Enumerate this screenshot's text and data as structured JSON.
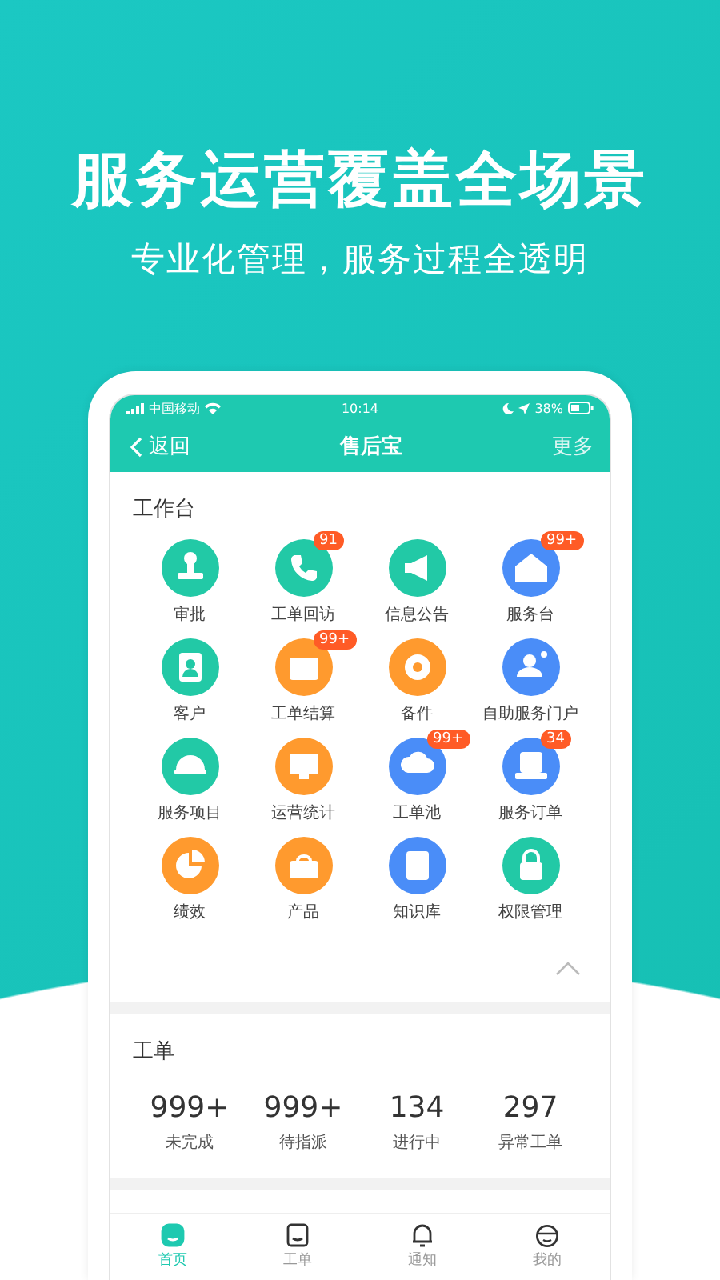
{
  "headline": "服务运营覆盖全场景",
  "subtitle": "专业化管理，服务过程全透明",
  "status_bar": {
    "carrier": "中国移动",
    "time": "10:14",
    "battery": "38%"
  },
  "nav": {
    "back": "返回",
    "title": "售后宝",
    "more": "更多"
  },
  "workbench": {
    "title": "工作台",
    "items": [
      {
        "label": "审批",
        "color": "#22c9a6"
      },
      {
        "label": "工单回访",
        "color": "#22c9a6",
        "badge": "91"
      },
      {
        "label": "信息公告",
        "color": "#22c9a6"
      },
      {
        "label": "服务台",
        "color": "#4a8df8",
        "badge": "99+"
      },
      {
        "label": "客户",
        "color": "#22c9a6"
      },
      {
        "label": "工单结算",
        "color": "#ff9a2e",
        "badge": "99+"
      },
      {
        "label": "备件",
        "color": "#ff9a2e"
      },
      {
        "label": "自助服务门户",
        "color": "#4a8df8"
      },
      {
        "label": "服务项目",
        "color": "#22c9a6"
      },
      {
        "label": "运营统计",
        "color": "#ff9a2e"
      },
      {
        "label": "工单池",
        "color": "#4a8df8",
        "badge": "99+"
      },
      {
        "label": "服务订单",
        "color": "#4a8df8",
        "badge": "34"
      },
      {
        "label": "绩效",
        "color": "#ff9a2e"
      },
      {
        "label": "产品",
        "color": "#ff9a2e"
      },
      {
        "label": "知识库",
        "color": "#4a8df8"
      },
      {
        "label": "权限管理",
        "color": "#22c9a6"
      }
    ]
  },
  "orders": {
    "title": "工单",
    "stats": [
      {
        "value": "999+",
        "label": "未完成"
      },
      {
        "value": "999+",
        "label": "待指派"
      },
      {
        "value": "134",
        "label": "进行中"
      },
      {
        "value": "297",
        "label": "异常工单"
      }
    ]
  },
  "tabs": [
    {
      "label": "首页",
      "selected": true
    },
    {
      "label": "工单",
      "selected": false
    },
    {
      "label": "通知",
      "selected": false
    },
    {
      "label": "我的",
      "selected": false
    }
  ]
}
